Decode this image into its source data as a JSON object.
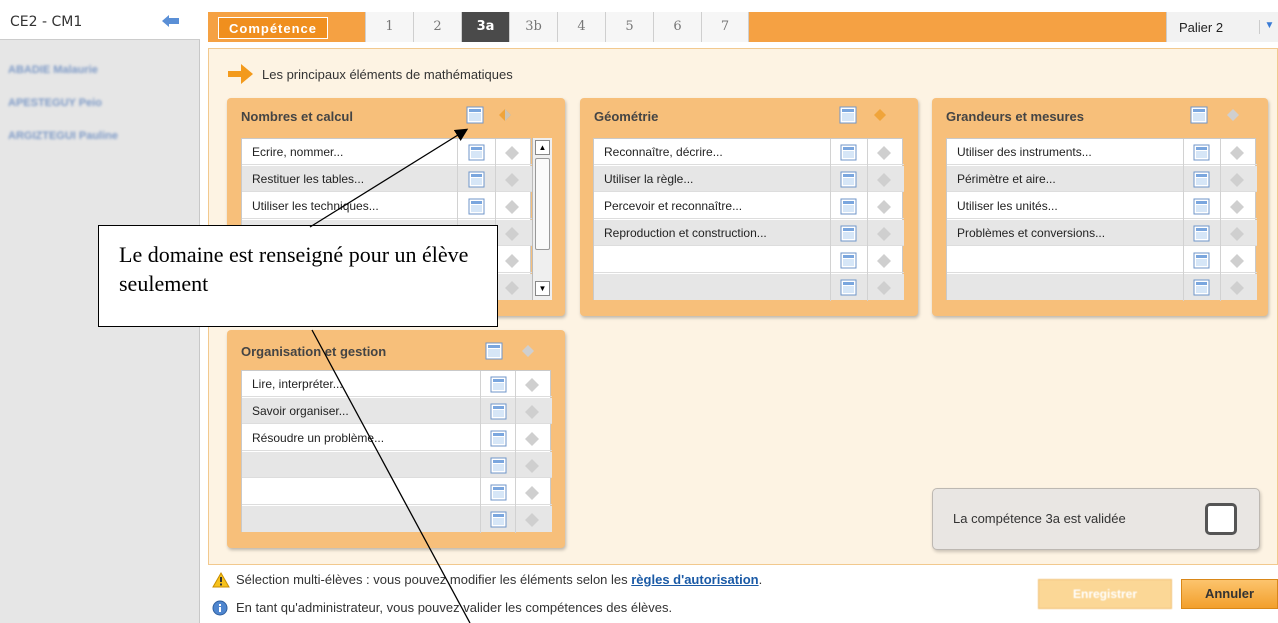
{
  "sidebar": {
    "class_title": "CE2 - CM1",
    "students": [
      "ABADIE Malaurie",
      "APESTEGUY Peio",
      "ARGIZTEGUI Pauline"
    ]
  },
  "tabbar": {
    "competence_label": "Compétence",
    "tabs": [
      "1",
      "2",
      "3a",
      "3b",
      "4",
      "5",
      "6",
      "7"
    ],
    "active_tab": "3a",
    "palier_label": "Palier 2"
  },
  "section": {
    "title": "Les principaux éléments de mathématiques"
  },
  "domains": {
    "nombres": {
      "title": "Nombres et calcul",
      "items": [
        "Ecrire, nommer...",
        "Restituer les tables...",
        "Utiliser les techniques..."
      ]
    },
    "geometrie": {
      "title": "Géométrie",
      "items": [
        "Reconnaître, décrire...",
        "Utiliser la règle...",
        "Percevoir et reconnaître...",
        "Reproduction et construction..."
      ]
    },
    "grandeurs": {
      "title": "Grandeurs et mesures",
      "items": [
        "Utiliser des instruments...",
        "Périmètre et aire...",
        "Utiliser les unités...",
        "Problèmes et conversions..."
      ]
    },
    "organisation": {
      "title": "Organisation et gestion",
      "items": [
        "Lire, interpréter...",
        "Savoir organiser...",
        "Résoudre un problème..."
      ]
    }
  },
  "validation": {
    "label": "La compétence 3a est validée",
    "checked": false
  },
  "footer": {
    "warning_prefix": "Sélection multi-élèves : vous pouvez modifier les éléments selon les ",
    "warning_link": "règles d'autorisation",
    "warning_suffix": ".",
    "info": "En tant qu'administrateur, vous pouvez valider les compétences des élèves."
  },
  "buttons": {
    "save": "Enregistrer",
    "cancel": "Annuler"
  },
  "annotation": {
    "text": "Le domaine est renseigné pour un élève seulement"
  },
  "colors": {
    "accent_orange": "#f5a143",
    "domain_bg": "#f7bf7a",
    "link_blue": "#1a5aa6"
  }
}
